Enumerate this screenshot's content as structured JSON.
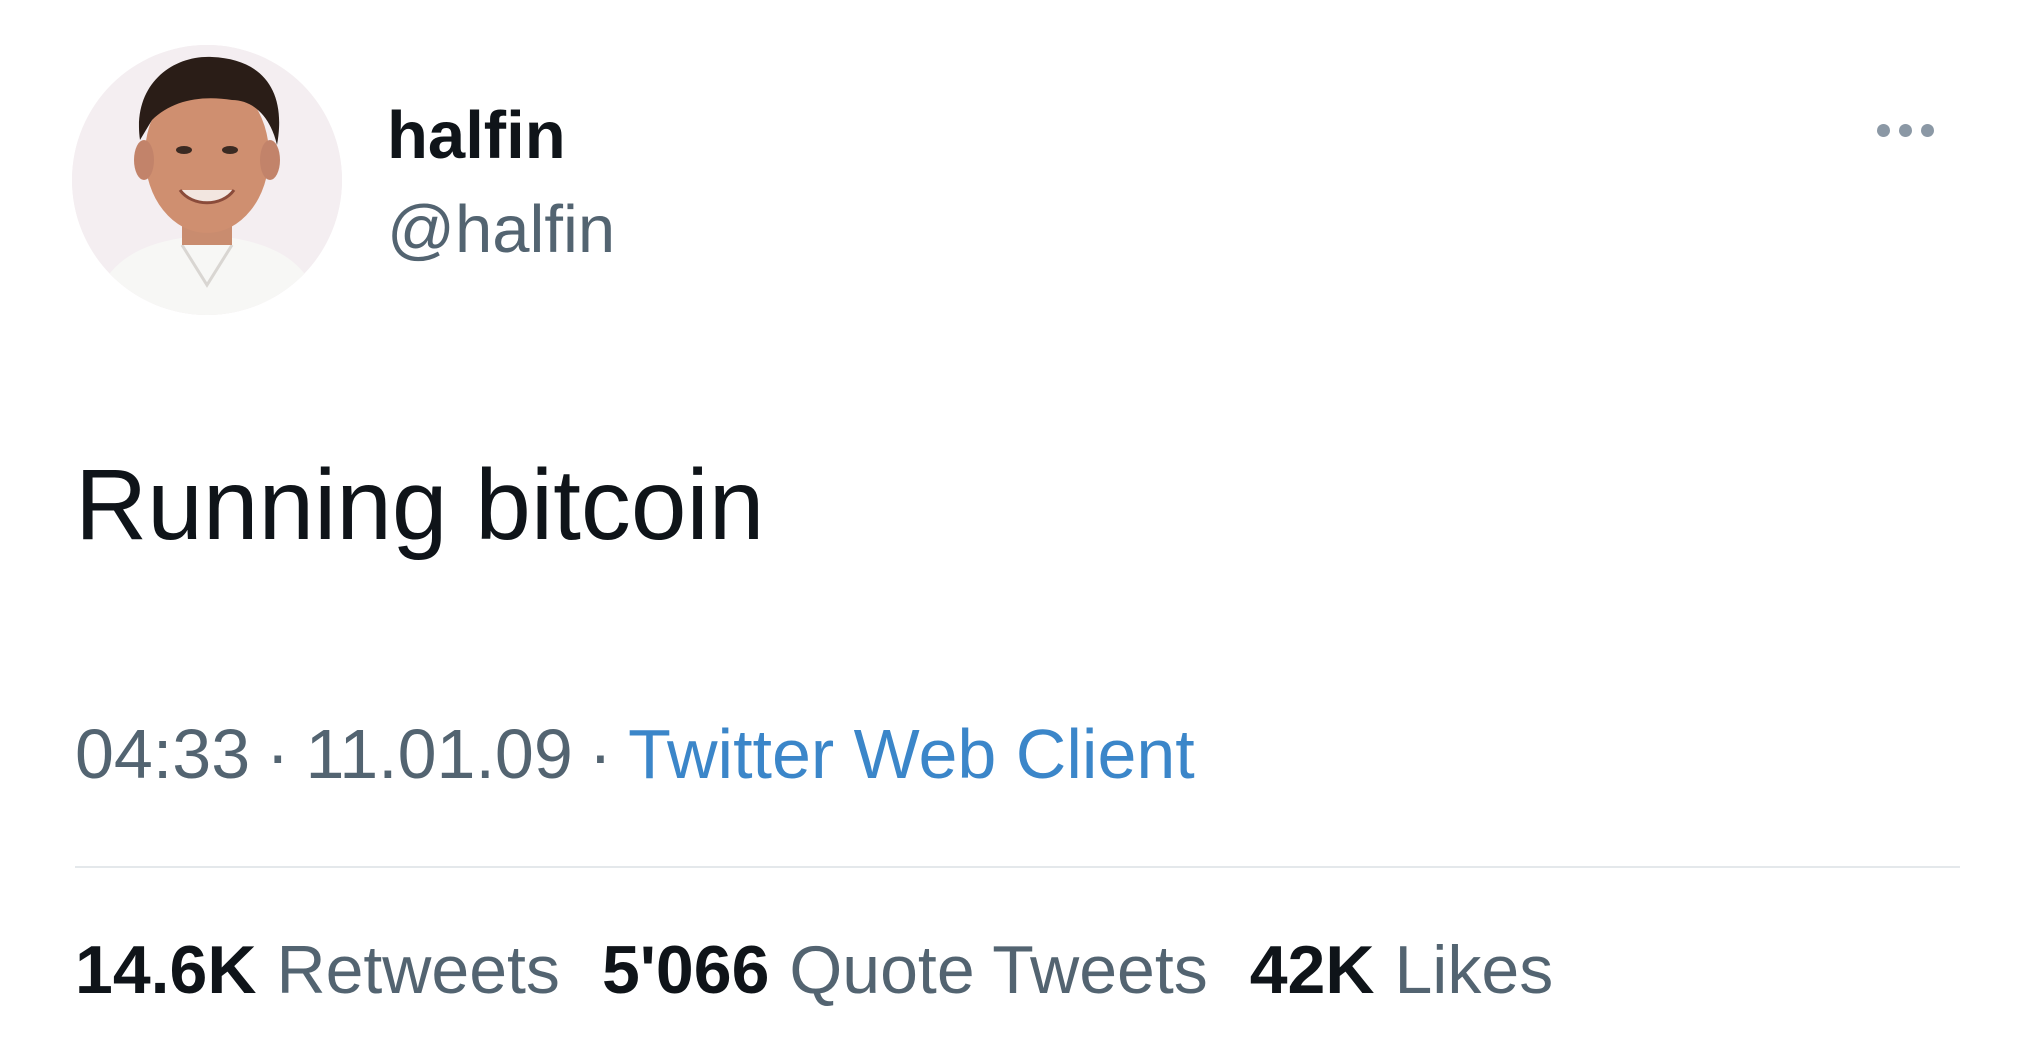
{
  "user": {
    "display_name": "halfin",
    "handle": "@halfin"
  },
  "tweet": {
    "text": "Running bitcoin",
    "time": "04:33",
    "date": "11.01.09",
    "source": "Twitter Web Client",
    "separator": "·"
  },
  "stats": {
    "retweets_count": "14.6K",
    "retweets_label": "Retweets",
    "quotes_count": "5'066",
    "quotes_label": "Quote Tweets",
    "likes_count": "42K",
    "likes_label": "Likes"
  },
  "icons": {
    "more": "more-dots-icon"
  },
  "colors": {
    "text": "#0f1419",
    "secondary": "#536471",
    "link": "#3b86c9",
    "divider": "#e4e8eb"
  }
}
